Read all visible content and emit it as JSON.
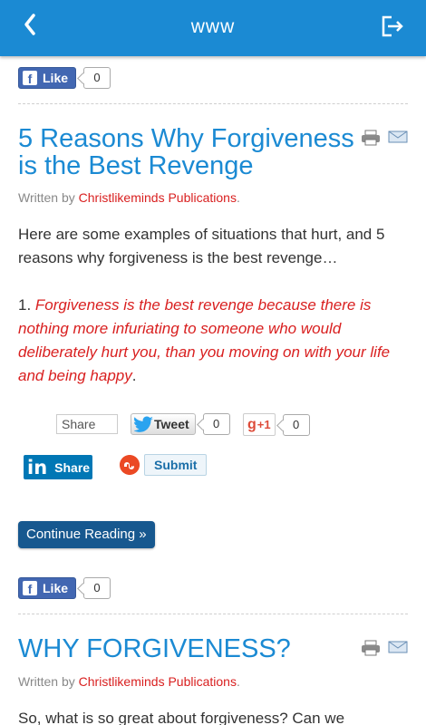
{
  "appbar": {
    "title": "www",
    "back_icon": "chevron-left-icon",
    "exit_icon": "logout-icon",
    "color": "#1b8ad3"
  },
  "fb_like_1": {
    "label": "Like",
    "count": "0"
  },
  "article_1": {
    "title": "5 Reasons Why Forgiveness is the Best Revenge",
    "written_by": "Written by",
    "author": "Christlikeminds Publications",
    "byline_end": ".",
    "intro": "Here are some examples of situations that hurt, and 5 reasons why forgiveness is the best revenge…",
    "point_number": "1.",
    "point_text": "Forgiveness is the best revenge because there is nothing more infuriating to someone who would deliberately hurt you, than you moving on with your life and being happy",
    "point_end": "."
  },
  "share_row": {
    "share_label": "Share",
    "tweet_label": "Tweet",
    "tweet_count": "0",
    "gplus_label": "g",
    "gplus_suffix": "+1",
    "gplus_count": "0",
    "linkedin_label": "Share",
    "linkedin_logo": "in",
    "stumble_label": "Submit"
  },
  "continue_label": "Continue Reading »",
  "fb_like_2": {
    "label": "Like",
    "count": "0"
  },
  "article_2": {
    "title": "WHY FORGIVENESS?",
    "written_by": "Written by",
    "author": "Christlikeminds Publications",
    "byline_end": ".",
    "intro": "So, what is so great about forgiveness? Can we"
  },
  "colors": {
    "link": "#1b8ad3",
    "accent_red": "#d92020",
    "button_dark": "#17588f"
  }
}
